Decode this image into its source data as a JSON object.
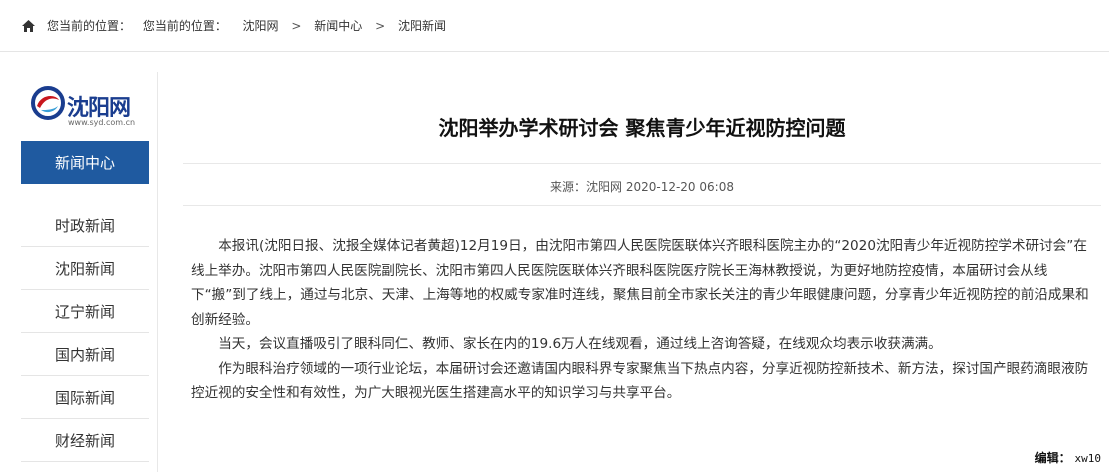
{
  "breadcrumb": {
    "icon": "home-icon",
    "items": [
      "您当前的位置：",
      "您当前的位置：",
      "沈阳网",
      "新闻中心",
      "沈阳新闻"
    ]
  },
  "sidebar": {
    "logo": {
      "name": "沈阳网",
      "url": "www.syd.com.cn",
      "icon": "syd-logo-icon"
    },
    "active": "新闻中心",
    "items": [
      "时政新闻",
      "沈阳新闻",
      "辽宁新闻",
      "国内新闻",
      "国际新闻",
      "财经新闻"
    ]
  },
  "article": {
    "title": "沈阳举办学术研讨会 聚焦青少年近视防控问题",
    "meta": "来源：沈阳网 2020-12-20 06:08",
    "paragraphs": [
      "本报讯(沈阳日报、沈报全媒体记者黄超)12月19日，由沈阳市第四人民医院医联体兴齐眼科医院主办的“2020沈阳青少年近视防控学术研讨会”在线上举办。沈阳市第四人民医院副院长、沈阳市第四人民医院医联体兴齐眼科医院医疗院长王海林教授说，为更好地防控疫情，本届研讨会从线下“搬”到了线上，通过与北京、天津、上海等地的权威专家准时连线，聚焦目前全市家长关注的青少年眼健康问题，分享青少年近视防控的前沿成果和创新经验。",
      "当天，会议直播吸引了眼科同仁、教师、家长在内的19.6万人在线观看，通过线上咨询答疑，在线观众均表示收获满满。",
      "作为眼科治疗领域的一项行业论坛，本届研讨会还邀请国内眼科界专家聚焦当下热点内容，分享近视防控新技术、新方法，探讨国产眼药滴眼液防控近视的安全性和有效性，为广大眼视光医生搭建高水平的知识学习与共享平台。"
    ],
    "editor_label": "编辑：",
    "editor_name": "xw10"
  },
  "colors": {
    "nav_active_bg": "#1f5aa0",
    "logo_blue": "#1a3d8f",
    "logo_red": "#c8161d"
  }
}
